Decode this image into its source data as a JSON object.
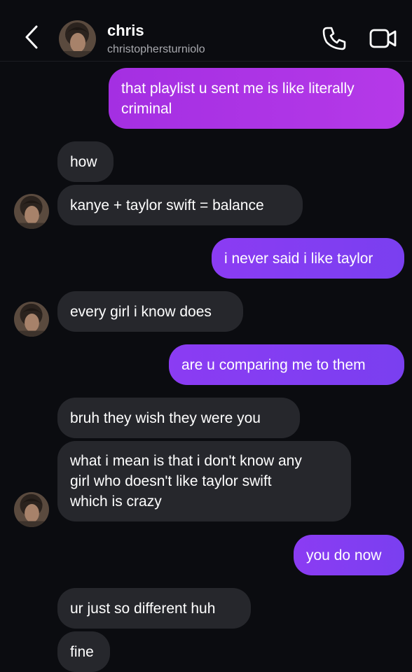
{
  "header": {
    "name": "chris",
    "username": "christophersturniolo"
  },
  "messages": [
    {
      "sender": "me",
      "text": "that playlist u sent me is like literally\ncriminal"
    },
    {
      "sender": "them",
      "text": "how"
    },
    {
      "sender": "them",
      "text": "kanye + taylor swift = balance"
    },
    {
      "sender": "me",
      "text": "i never said i like taylor"
    },
    {
      "sender": "them",
      "text": "every girl i know does"
    },
    {
      "sender": "me",
      "text": "are u comparing me to them"
    },
    {
      "sender": "them",
      "text": "bruh they wish they were you"
    },
    {
      "sender": "them",
      "text": "what i mean is that i don't know any\ngirl who doesn't like taylor swift\nwhich is crazy"
    },
    {
      "sender": "me",
      "text": "you do now"
    },
    {
      "sender": "them",
      "text": "ur just so different huh"
    },
    {
      "sender": "them",
      "text": "fine"
    }
  ],
  "icons": {
    "back": "chevron-left-icon",
    "call": "phone-icon",
    "video": "video-camera-icon"
  },
  "colors": {
    "background": "#0b0c10",
    "incoming_bubble": "#26272c",
    "outgoing_bubble": "#8b3cf3",
    "outgoing_bubble_top": "#b036e6"
  }
}
